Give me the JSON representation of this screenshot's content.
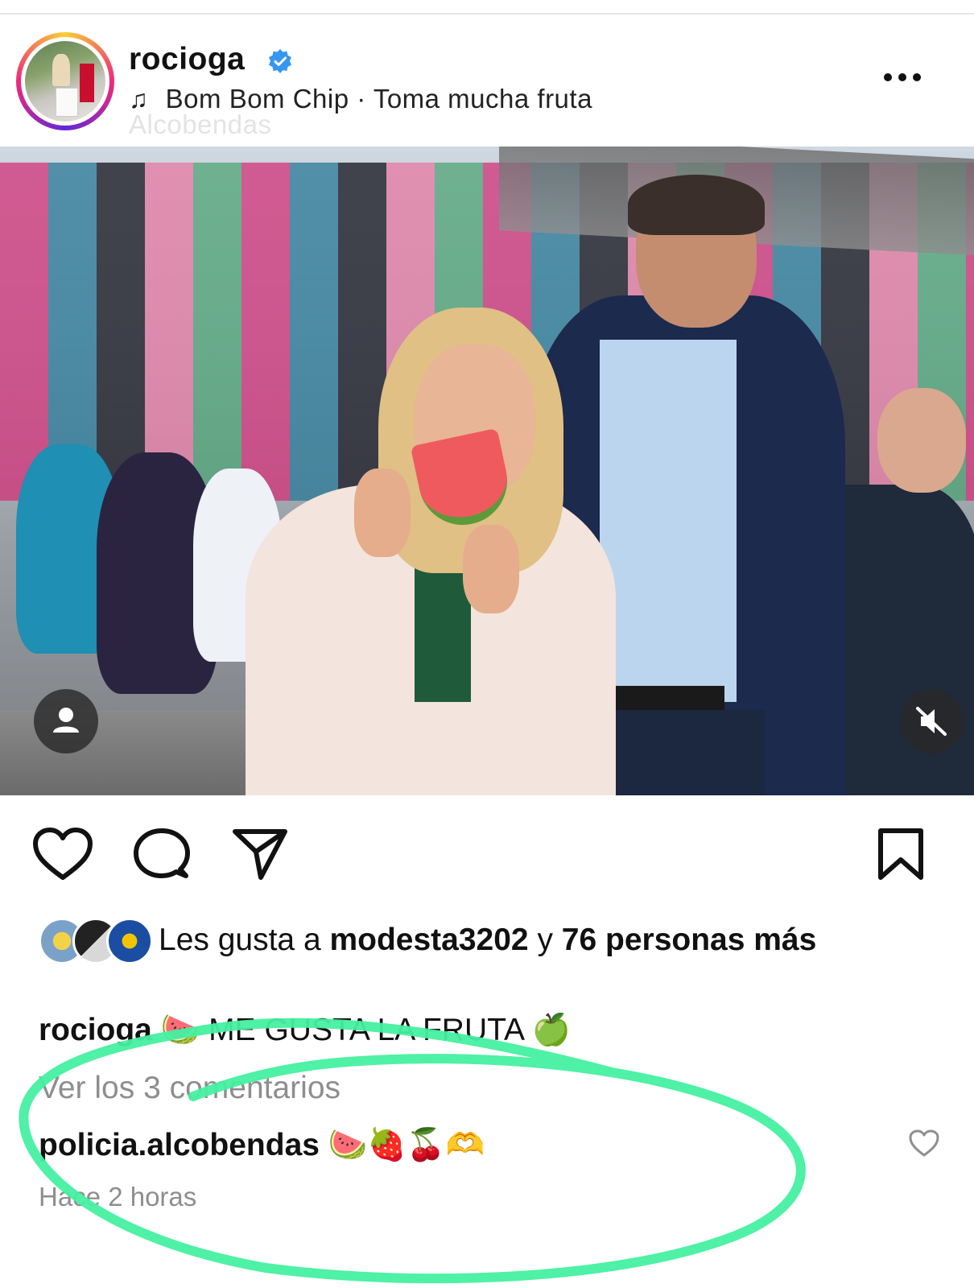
{
  "post": {
    "username": "rocioga",
    "audio": "Bom Bom Chip · Toma mucha fruta",
    "location": "Alcobendas"
  },
  "likes": {
    "prefix": "Les gusta a ",
    "user": "modesta3202",
    "middle": " y ",
    "rest": "76 personas más"
  },
  "caption": {
    "username": "rocioga",
    "text": "🍉 ME GUSTA LA FRUTA 🍏"
  },
  "comments": {
    "view_all": "Ver los 3 comentarios",
    "first": {
      "username": "policia.alcobendas",
      "text": "🍉🍓🍒🫶"
    },
    "timestamp": "Hace 2 horas"
  },
  "icons": {
    "verified": "verified-badge-icon",
    "music": "music-note-icon",
    "more": "more-options-icon",
    "like": "heart-icon",
    "comment": "comment-icon",
    "share": "send-icon",
    "save": "bookmark-icon",
    "tagged_user": "tagged-user-icon",
    "mute": "muted-speaker-icon"
  },
  "colors": {
    "verified_blue": "#3797f0",
    "highlight_green": "#44f0a0",
    "muted_text": "#8e8e8e"
  }
}
